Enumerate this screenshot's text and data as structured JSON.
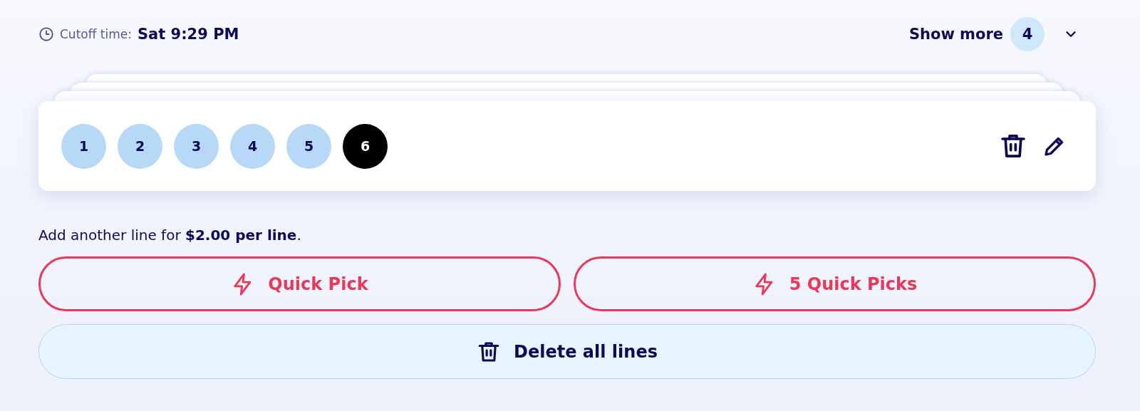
{
  "cutoff": {
    "label": "Cutoff time:",
    "value": "Sat 9:29 PM"
  },
  "show_more": {
    "label": "Show more",
    "count": "4",
    "expanded": false
  },
  "line": {
    "balls": [
      {
        "number": "1",
        "kind": "main"
      },
      {
        "number": "2",
        "kind": "main"
      },
      {
        "number": "3",
        "kind": "main"
      },
      {
        "number": "4",
        "kind": "main"
      },
      {
        "number": "5",
        "kind": "main"
      },
      {
        "number": "6",
        "kind": "bonus"
      }
    ]
  },
  "add_line_text": "Add another line for **$2.00 per line**.",
  "buttons": [
    {
      "label": "Quick Pick",
      "kind": "quick"
    },
    {
      "label": "5 Quick Picks",
      "kind": "quick"
    },
    {
      "label": "Delete all lines",
      "kind": "delete"
    }
  ]
}
